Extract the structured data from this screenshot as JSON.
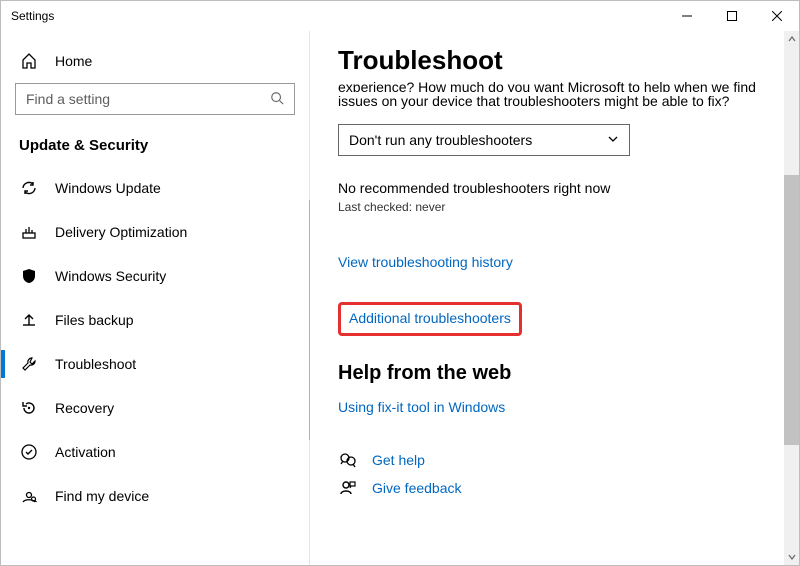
{
  "window": {
    "title": "Settings"
  },
  "sidebar": {
    "home_label": "Home",
    "search_placeholder": "Find a setting",
    "section_heading": "Update & Security",
    "items": [
      {
        "label": "Windows Update"
      },
      {
        "label": "Delivery Optimization"
      },
      {
        "label": "Windows Security"
      },
      {
        "label": "Files backup"
      },
      {
        "label": "Troubleshoot"
      },
      {
        "label": "Recovery"
      },
      {
        "label": "Activation"
      },
      {
        "label": "Find my device"
      }
    ]
  },
  "main": {
    "page_title": "Troubleshoot",
    "truncated_line": "experience? How much do you want Microsoft to help when we find",
    "intro_line": "issues on your device that troubleshooters might be able to fix?",
    "dropdown_value": "Don't run any troubleshooters",
    "status_text": "No recommended troubleshooters right now",
    "last_checked": "Last checked: never",
    "view_history": "View troubleshooting history",
    "additional": "Additional troubleshooters",
    "help_heading": "Help from the web",
    "help_link": "Using fix-it tool in Windows",
    "get_help": "Get help",
    "give_feedback": "Give feedback"
  }
}
